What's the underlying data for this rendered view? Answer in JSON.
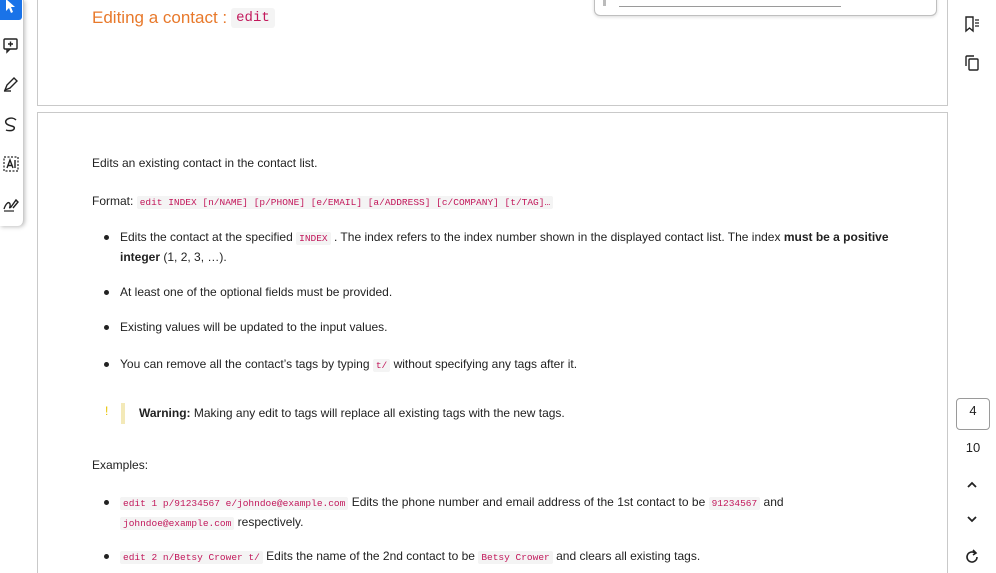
{
  "heading": {
    "title": "Editing a contact :",
    "command": "edit"
  },
  "intro": "Edits an existing contact in the contact list.",
  "format": {
    "label": "Format:",
    "code": "edit INDEX [n/NAME] [p/PHONE] [e/EMAIL] [a/ADDRESS] [c/COMPANY] [t/TAG]…"
  },
  "bullets": {
    "b1": {
      "pre": "Edits the contact at the specified",
      "code": "INDEX",
      "mid": ". The index refers to the index number shown in the displayed contact list. The index",
      "bold": "must be a positive integer",
      "post": "(1, 2, 3, …)."
    },
    "b2": "At least one of the optional fields must be provided.",
    "b3": "Existing values will be updated to the input values.",
    "b4": {
      "pre": "You can remove all the contact’s tags by typing",
      "code": "t/",
      "post": "without specifying any tags after it."
    }
  },
  "warning": {
    "mark": "!",
    "label": "Warning:",
    "text": "Making any edit to tags will replace all existing tags with the new tags."
  },
  "examples_label": "Examples:",
  "examples": {
    "e1": {
      "code": "edit 1 p/91234567 e/johndoe@example.com",
      "text": "Edits the phone number and email address of the 1st contact to be",
      "code2": "91234567",
      "and": "and",
      "code3": "johndoe@example.com",
      "post": "respectively."
    },
    "e2": {
      "code": "edit 2 n/Betsy Crower t/",
      "text": "Edits the name of the 2nd contact to be",
      "code2": "Betsy Crower",
      "post": "and clears all existing tags."
    }
  },
  "pager": {
    "current": "4",
    "total": "10"
  },
  "colors": {
    "heading": "#e8792b",
    "code": "#c2185b",
    "accent": "#1a73e8"
  },
  "icons": {
    "left_toolbar": [
      "select-cursor-icon",
      "add-comment-icon",
      "highlight-pen-icon",
      "draw-icon",
      "text-box-icon",
      "signature-icon"
    ],
    "right_bar": [
      "bookmark-list-icon",
      "copy-pages-icon",
      "chevron-up-icon",
      "chevron-down-icon",
      "refresh-icon"
    ]
  }
}
